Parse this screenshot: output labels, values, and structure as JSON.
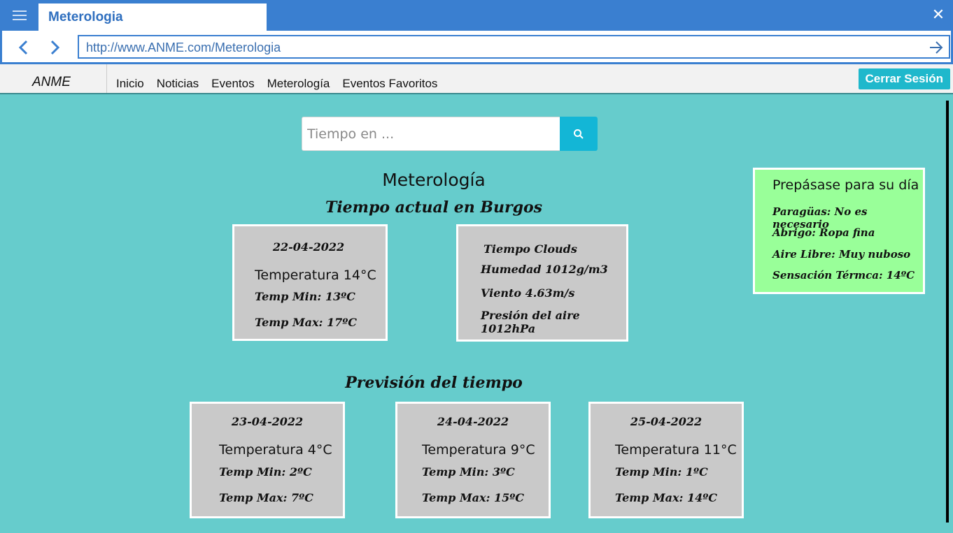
{
  "browser": {
    "tab_title": "Meterologia",
    "url": "http://www.ANME.com/Meterologia"
  },
  "navbar": {
    "brand": "ANME",
    "links": [
      "Inicio",
      "Noticias",
      "Eventos",
      "Meterología",
      "Eventos Favoritos"
    ],
    "logout_label": "Cerrar Sesión"
  },
  "search": {
    "placeholder": "Tiempo en ..."
  },
  "page": {
    "title": "Meterología",
    "current_title": "Tiempo actual en Burgos",
    "forecast_title": "Previsión del tiempo"
  },
  "current": {
    "date": "22-04-2022",
    "temperature": "Temperatura 14°C",
    "temp_min": "Temp Min: 13ºC",
    "temp_max": "Temp Max: 17ºC"
  },
  "details": {
    "sky": "Tiempo  Clouds",
    "humidity": "Humedad 1012g/m3",
    "wind": "Viento 4.63m/s",
    "pressure": "Presión del aire 1012hPa"
  },
  "prepare": {
    "title": "Prepásase para su día",
    "umbrella": "Paragüas: No es necesario",
    "coat": "Abrigo: Ropa fina",
    "outdoor": "Aire Libre: Muy nuboso",
    "feels_like": "Sensación Térmca: 14ºC"
  },
  "forecast": [
    {
      "date": "23-04-2022",
      "temperature": "Temperatura 4°C",
      "temp_min": "Temp Min: 2ºC",
      "temp_max": "Temp Max: 7ºC"
    },
    {
      "date": "24-04-2022",
      "temperature": "Temperatura 9°C",
      "temp_min": "Temp Min: 3ºC",
      "temp_max": "Temp Max: 15ºC"
    },
    {
      "date": "25-04-2022",
      "temperature": "Temperatura 11°C",
      "temp_min": "Temp Min: 1ºC",
      "temp_max": "Temp Max: 14ºC"
    }
  ],
  "colors": {
    "chrome_blue": "#3a7fd0",
    "page_background": "#66cccc",
    "card_background": "#c9c9c9",
    "prepare_background": "#99ff99",
    "accent_button": "#1fb8cc"
  }
}
